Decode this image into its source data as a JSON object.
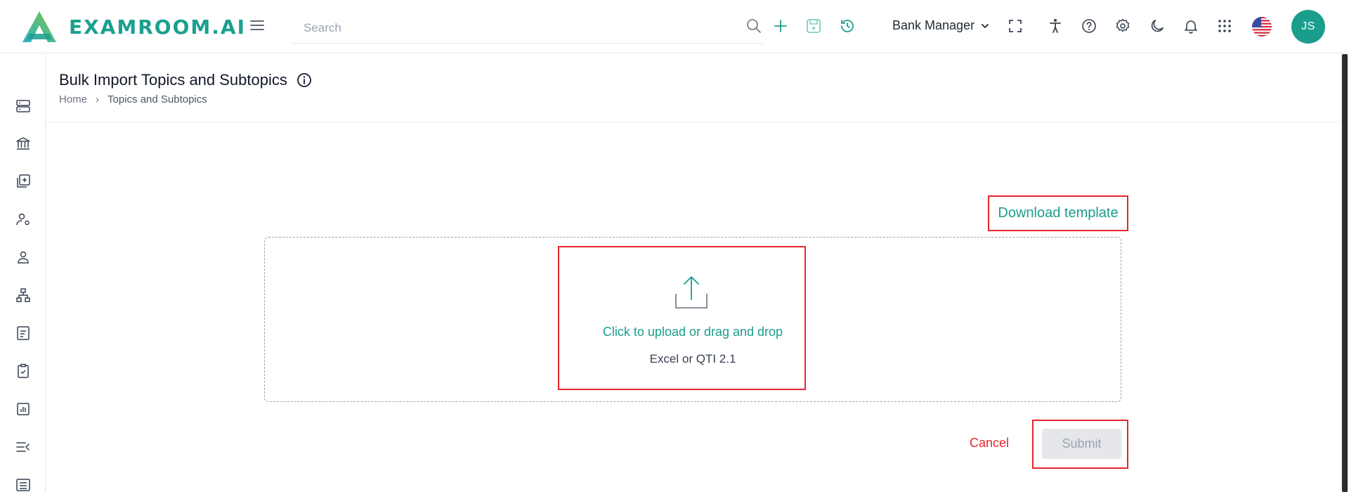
{
  "brand": {
    "name": "EXAMROOM.AI",
    "color": "#1aa08e"
  },
  "header": {
    "search_placeholder": "Search",
    "role_label": "Bank Manager",
    "avatar_initials": "JS",
    "icons": [
      "search-icon",
      "add-icon",
      "save-icon",
      "history-icon",
      "fullscreen-icon",
      "accessibility-icon",
      "help-icon",
      "settings-icon",
      "dark-mode-icon",
      "notifications-icon",
      "apps-grid-icon",
      "us-flag-icon"
    ]
  },
  "sidebar": {
    "icons": [
      "server-icon",
      "bank-icon",
      "library-add-icon",
      "user-settings-icon",
      "user-icon",
      "hierarchy-icon",
      "document-icon",
      "clipboard-check-icon",
      "report-chart-icon",
      "collapse-menu-icon",
      "list-table-icon"
    ]
  },
  "page": {
    "title": "Bulk Import Topics and Subtopics",
    "breadcrumb": {
      "home": "Home",
      "separator": "›",
      "current": "Topics and Subtopics"
    }
  },
  "upload": {
    "download_template": "Download template",
    "prompt": "Click to upload or drag and drop",
    "formats": "Excel or QTI 2.1"
  },
  "actions": {
    "cancel": "Cancel",
    "submit": "Submit"
  },
  "colors": {
    "accent": "#1a9e8c",
    "danger": "#e5262b",
    "disabled_bg": "#e5e7eb"
  }
}
